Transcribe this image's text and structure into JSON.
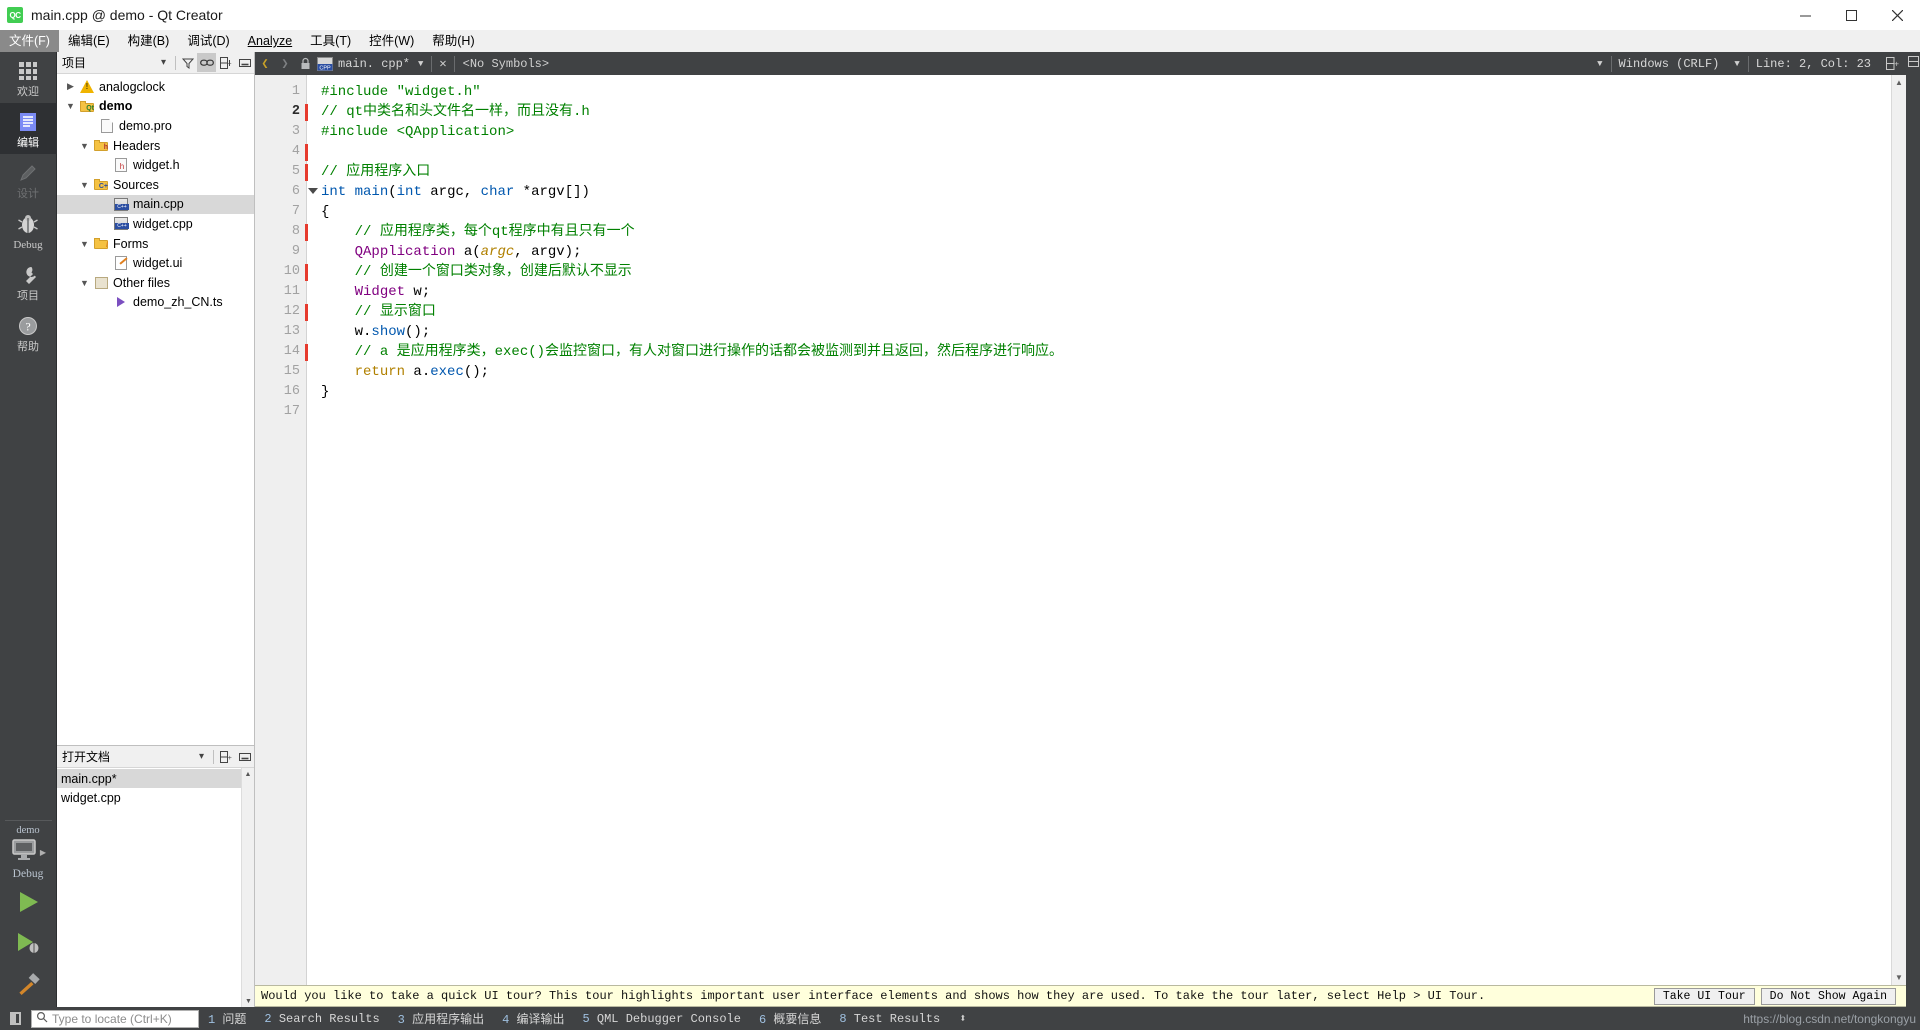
{
  "window": {
    "title": "main.cpp @ demo - Qt Creator",
    "icon": "qt-creator-logo-icon",
    "controls": {
      "minimize": "minimize-icon",
      "maximize": "maximize-icon",
      "close": "close-icon"
    }
  },
  "menubar": {
    "items": [
      {
        "label": "文件(F)",
        "mnemonic": "F",
        "active": true
      },
      {
        "label": "编辑(E)",
        "mnemonic": "E",
        "active": false
      },
      {
        "label": "构建(B)",
        "mnemonic": "B",
        "active": false
      },
      {
        "label": "调试(D)",
        "mnemonic": "D",
        "active": false
      },
      {
        "label": "Analyze",
        "mnemonic": "A",
        "active": false
      },
      {
        "label": "工具(T)",
        "mnemonic": "T",
        "active": false
      },
      {
        "label": "控件(W)",
        "mnemonic": "W",
        "active": false
      },
      {
        "label": "帮助(H)",
        "mnemonic": "H",
        "active": false
      }
    ]
  },
  "modebar": {
    "items": [
      {
        "label": "欢迎",
        "icon": "grid-icon",
        "state": "normal"
      },
      {
        "label": "编辑",
        "icon": "document-lines-icon",
        "state": "selected"
      },
      {
        "label": "设计",
        "icon": "pencil-icon",
        "state": "disabled"
      },
      {
        "label": "Debug",
        "icon": "bug-icon",
        "state": "normal"
      },
      {
        "label": "项目",
        "icon": "wrench-icon",
        "state": "normal"
      },
      {
        "label": "帮助",
        "icon": "question-mark-icon",
        "state": "normal"
      }
    ],
    "kit": {
      "project": "demo",
      "build_config": "Debug",
      "target_icon": "desktop-monitor-icon",
      "run_button": "run-play-icon",
      "debug_button": "run-debug-icon",
      "build_button": "hammer-icon"
    }
  },
  "project_pane": {
    "title": "项目",
    "toolbar": [
      {
        "name": "view-dropdown",
        "icon": "chevron-down-icon"
      },
      {
        "name": "filter",
        "icon": "filter-icon"
      },
      {
        "name": "sync-with-editor",
        "icon": "link-icon",
        "active": true
      },
      {
        "name": "split",
        "icon": "split-icon"
      },
      {
        "name": "close-pane",
        "icon": "minimize-pane-icon"
      }
    ],
    "tree": [
      {
        "label": "analogclock",
        "indent": 0,
        "twist": "collapsed",
        "icon": "warning-icon",
        "bold": false,
        "selected": false
      },
      {
        "label": "demo",
        "indent": 0,
        "twist": "expanded",
        "icon": "qt-folder-icon",
        "bold": true,
        "selected": false
      },
      {
        "label": "demo.pro",
        "indent": 1,
        "twist": "none",
        "icon": "pro-file-icon",
        "bold": false,
        "selected": false
      },
      {
        "label": "Headers",
        "indent": 1,
        "twist": "expanded",
        "icon": "h-folder-icon",
        "bold": false,
        "selected": false
      },
      {
        "label": "widget.h",
        "indent": 2,
        "twist": "none",
        "icon": "h-file-icon",
        "bold": false,
        "selected": false
      },
      {
        "label": "Sources",
        "indent": 1,
        "twist": "expanded",
        "icon": "cpp-folder-icon",
        "bold": false,
        "selected": false
      },
      {
        "label": "main.cpp",
        "indent": 2,
        "twist": "none",
        "icon": "cpp-file-icon",
        "bold": false,
        "selected": true
      },
      {
        "label": "widget.cpp",
        "indent": 2,
        "twist": "none",
        "icon": "cpp-file-icon",
        "bold": false,
        "selected": false
      },
      {
        "label": "Forms",
        "indent": 1,
        "twist": "expanded",
        "icon": "forms-folder-icon",
        "bold": false,
        "selected": false
      },
      {
        "label": "widget.ui",
        "indent": 2,
        "twist": "none",
        "icon": "ui-file-icon",
        "bold": false,
        "selected": false
      },
      {
        "label": "Other files",
        "indent": 1,
        "twist": "expanded",
        "icon": "other-files-icon",
        "bold": false,
        "selected": false
      },
      {
        "label": "demo_zh_CN.ts",
        "indent": 2,
        "twist": "none",
        "icon": "ts-file-icon",
        "bold": false,
        "selected": false
      }
    ]
  },
  "open_documents_pane": {
    "title": "打开文档",
    "toolbar": [
      {
        "name": "sort-dropdown",
        "icon": "chevron-down-icon"
      },
      {
        "name": "split",
        "icon": "split-icon"
      },
      {
        "name": "close-pane",
        "icon": "minimize-pane-icon"
      }
    ],
    "items": [
      {
        "label": "main.cpp*",
        "selected": true
      },
      {
        "label": "widget.cpp",
        "selected": false
      }
    ]
  },
  "editor_toolbar": {
    "back": "back-arrow-icon",
    "forward": "forward-arrow-icon",
    "lock": "lock-icon",
    "file_icon": "cpp-file-icon",
    "file_name": "main. cpp*",
    "file_dropdown": "chevron-down-icon",
    "close_file": "close-icon",
    "symbol_selector": "<No Symbols>",
    "symbol_dropdown": "chevron-down-icon",
    "line_ending": "Windows (CRLF)",
    "line_ending_dropdown": "chevron-down-icon",
    "cursor_position": "Line: 2, Col: 23",
    "split_editor": "split-icon"
  },
  "editor": {
    "total_lines": 17,
    "current_line": 2,
    "modified_lines": [
      2,
      4,
      5,
      8,
      10,
      12,
      14
    ],
    "fold_lines": [
      6
    ],
    "lines": [
      {
        "n": 1,
        "tokens": [
          {
            "t": "#include ",
            "c": "k-pre"
          },
          {
            "t": "\"widget.h\"",
            "c": "k-str"
          }
        ]
      },
      {
        "n": 2,
        "tokens": [
          {
            "t": "// qt中类名和头文件名一样，而且没有.h",
            "c": "k-cmt"
          }
        ]
      },
      {
        "n": 3,
        "tokens": [
          {
            "t": "#include ",
            "c": "k-pre"
          },
          {
            "t": "<QApplication>",
            "c": "k-str"
          }
        ]
      },
      {
        "n": 4,
        "tokens": []
      },
      {
        "n": 5,
        "tokens": [
          {
            "t": "// 应用程序入口",
            "c": "k-cmt"
          }
        ]
      },
      {
        "n": 6,
        "tokens": [
          {
            "t": "int",
            "c": "k-key"
          },
          {
            "t": " ",
            "c": "k-plain"
          },
          {
            "t": "main",
            "c": "k-fn"
          },
          {
            "t": "(",
            "c": "k-plain"
          },
          {
            "t": "int",
            "c": "k-key"
          },
          {
            "t": " argc, ",
            "c": "k-plain"
          },
          {
            "t": "char",
            "c": "k-key"
          },
          {
            "t": " *argv[])",
            "c": "k-plain"
          }
        ]
      },
      {
        "n": 7,
        "tokens": [
          {
            "t": "{",
            "c": "k-plain"
          }
        ]
      },
      {
        "n": 8,
        "tokens": [
          {
            "t": "    ",
            "c": "k-plain"
          },
          {
            "t": "// 应用程序类，每个qt程序中有且只有一个",
            "c": "k-cmt"
          }
        ]
      },
      {
        "n": 9,
        "tokens": [
          {
            "t": "    ",
            "c": "k-plain"
          },
          {
            "t": "QApplication",
            "c": "k-type"
          },
          {
            "t": " a(",
            "c": "k-plain"
          },
          {
            "t": "argc",
            "c": "k-param"
          },
          {
            "t": ", argv);",
            "c": "k-plain"
          }
        ]
      },
      {
        "n": 10,
        "tokens": [
          {
            "t": "    ",
            "c": "k-plain"
          },
          {
            "t": "// 创建一个窗口类对象，创建后默认不显示",
            "c": "k-cmt"
          }
        ]
      },
      {
        "n": 11,
        "tokens": [
          {
            "t": "    ",
            "c": "k-plain"
          },
          {
            "t": "Widget",
            "c": "k-type"
          },
          {
            "t": " w;",
            "c": "k-plain"
          }
        ]
      },
      {
        "n": 12,
        "tokens": [
          {
            "t": "    ",
            "c": "k-plain"
          },
          {
            "t": "// 显示窗口",
            "c": "k-cmt"
          }
        ]
      },
      {
        "n": 13,
        "tokens": [
          {
            "t": "    w.",
            "c": "k-plain"
          },
          {
            "t": "show",
            "c": "k-fn"
          },
          {
            "t": "();",
            "c": "k-plain"
          }
        ]
      },
      {
        "n": 14,
        "tokens": [
          {
            "t": "    ",
            "c": "k-plain"
          },
          {
            "t": "// a 是应用程序类，exec()会监控窗口，有人对窗口进行操作的话都会被监测到并且返回，然后程序进行响应。",
            "c": "k-cmt"
          }
        ]
      },
      {
        "n": 15,
        "tokens": [
          {
            "t": "    ",
            "c": "k-plain"
          },
          {
            "t": "return",
            "c": "k-ret"
          },
          {
            "t": " a.",
            "c": "k-plain"
          },
          {
            "t": "exec",
            "c": "k-fn"
          },
          {
            "t": "();",
            "c": "k-plain"
          }
        ]
      },
      {
        "n": 16,
        "tokens": [
          {
            "t": "}",
            "c": "k-plain"
          }
        ]
      },
      {
        "n": 17,
        "tokens": []
      }
    ]
  },
  "tour_banner": {
    "message": "Would you like to take a quick UI tour? This tour highlights important user interface elements and shows how they are used. To take the tour later, select Help > UI Tour.",
    "primary_button": "Take UI Tour",
    "secondary_button": "Do Not Show Again"
  },
  "statusbar": {
    "sidebar_toggle": "sidebar-toggle-icon",
    "locator_placeholder": "Type to locate (Ctrl+K)",
    "locator_icon": "search-icon",
    "output_panes": [
      {
        "num": "1",
        "label": "问题"
      },
      {
        "num": "2",
        "label": "Search Results"
      },
      {
        "num": "3",
        "label": "应用程序输出"
      },
      {
        "num": "4",
        "label": "编译输出"
      },
      {
        "num": "5",
        "label": "QML Debugger Console"
      },
      {
        "num": "6",
        "label": "概要信息"
      },
      {
        "num": "8",
        "label": "Test Results"
      }
    ],
    "resize_handle": "up-down-arrows-icon",
    "watermark": "https://blog.csdn.net/tongkongyu"
  },
  "colors": {
    "dark_chrome": "#404244",
    "menu_bg": "#f0f0f0",
    "selection": "#d8d8d8",
    "comment_green": "#008000",
    "keyword_blue": "#0057ae",
    "type_purple": "#800080",
    "modified_red": "#e63b2e",
    "banner_yellow": "#ffffdc",
    "qt_green": "#41cd52"
  }
}
